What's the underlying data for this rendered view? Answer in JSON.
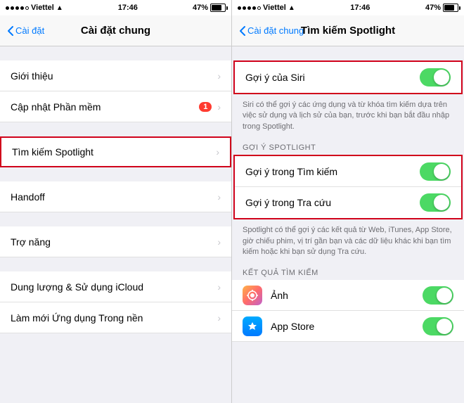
{
  "left_panel": {
    "status": {
      "carrier": "Viettel",
      "time": "17:46",
      "battery": "47%"
    },
    "nav": {
      "back_label": "Cài đặt",
      "title": "Cài đặt chung"
    },
    "items": [
      {
        "id": "gioi-thieu",
        "label": "Giới thiệu",
        "badge": null,
        "highlighted": false
      },
      {
        "id": "cap-nhat",
        "label": "Cập nhật Phần mềm",
        "badge": "1",
        "highlighted": false
      },
      {
        "id": "tim-kiem",
        "label": "Tìm kiếm Spotlight",
        "badge": null,
        "highlighted": true
      },
      {
        "id": "handoff",
        "label": "Handoff",
        "badge": null,
        "highlighted": false
      },
      {
        "id": "tro-nang",
        "label": "Trợ năng",
        "badge": null,
        "highlighted": false
      },
      {
        "id": "dung-luong",
        "label": "Dung lượng & Sử dụng iCloud",
        "badge": null,
        "highlighted": false
      },
      {
        "id": "lam-moi",
        "label": "Làm mới Ứng dụng Trong nền",
        "badge": null,
        "highlighted": false
      }
    ]
  },
  "right_panel": {
    "status": {
      "carrier": "Viettel",
      "time": "17:46",
      "battery": "47%"
    },
    "nav": {
      "back_label": "Cài đặt chung",
      "title": "Tìm kiếm Spotlight"
    },
    "siri_section": {
      "toggle_label": "Gợi ý của Siri",
      "toggle_state": true,
      "description": "Siri có thể gợi ý các ứng dụng và từ khóa tìm kiếm dựa trên việc sử dụng và lịch sử của bạn, trước khi bạn bắt đầu nhập trong Spotlight."
    },
    "spotlight_section": {
      "header": "GỢI Ý SPOTLIGHT",
      "items": [
        {
          "label": "Gợi ý trong Tìm kiếm",
          "toggle": true
        },
        {
          "label": "Gợi ý trong Tra cứu",
          "toggle": true
        }
      ],
      "description": "Spotlight có thể gợi ý các kết quả từ Web, iTunes, App Store, giờ chiếu phim, vị trí gần bạn và các dữ liệu khác khi bạn tìm kiếm hoặc khi bạn sử dụng Tra cứu."
    },
    "results_section": {
      "header": "KẾT QUẢ TÌM KIẾM",
      "items": [
        {
          "id": "anh",
          "label": "Ảnh",
          "icon_type": "photos",
          "toggle": true
        },
        {
          "id": "appstore",
          "label": "App Store",
          "icon_type": "appstore",
          "toggle": true
        }
      ]
    }
  }
}
